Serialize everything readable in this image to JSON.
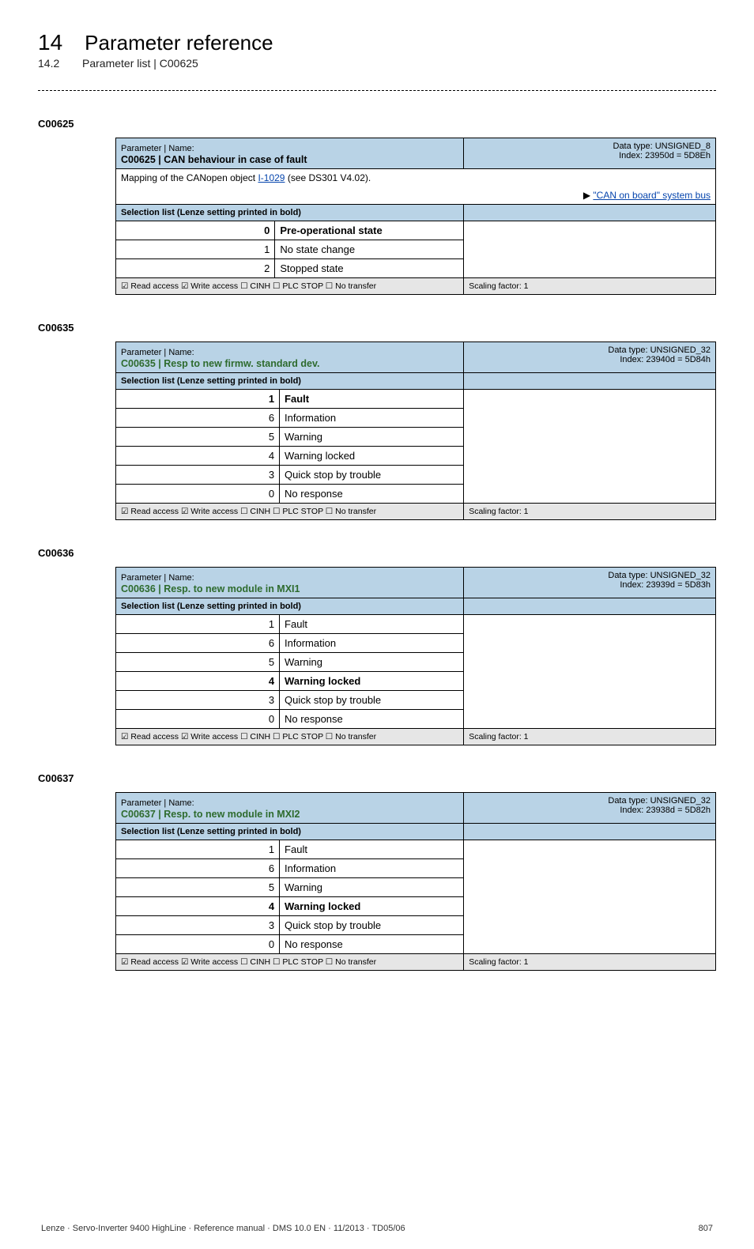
{
  "header": {
    "chapter_number": "14",
    "chapter_title": "Parameter reference",
    "sub_number": "14.2",
    "sub_title": "Parameter list | C00625"
  },
  "c00625": {
    "id": "C00625",
    "pn": "Parameter | Name:",
    "code_name": "C00625 | CAN behaviour in case of fault",
    "dtype_l1": "Data type: UNSIGNED_8",
    "dtype_l2": "Index: 23950d = 5D8Eh",
    "mapping_pre": "Mapping of the CANopen object ",
    "mapping_link": "I-1029",
    "mapping_post": "  (see DS301 V4.02).",
    "syslink": "\"CAN on board\" system bus",
    "sel": "Selection list (Lenze setting printed in bold)",
    "rows": [
      {
        "n": "0",
        "t": "Pre-operational state",
        "b": true
      },
      {
        "n": "1",
        "t": "No state change",
        "b": false
      },
      {
        "n": "2",
        "t": "Stopped state",
        "b": false
      }
    ],
    "foot_l": "☑ Read access   ☑ Write access   ☐ CINH   ☐ PLC STOP   ☐ No transfer",
    "foot_r": "Scaling factor: 1"
  },
  "c00635": {
    "id": "C00635",
    "pn": "Parameter | Name:",
    "code_name": "C00635 | Resp to new firmw. standard dev.",
    "dtype_l1": "Data type: UNSIGNED_32",
    "dtype_l2": "Index: 23940d = 5D84h",
    "sel": "Selection list (Lenze setting printed in bold)",
    "rows": [
      {
        "n": "1",
        "t": "Fault",
        "b": true
      },
      {
        "n": "6",
        "t": "Information",
        "b": false
      },
      {
        "n": "5",
        "t": "Warning",
        "b": false
      },
      {
        "n": "4",
        "t": "Warning locked",
        "b": false
      },
      {
        "n": "3",
        "t": "Quick stop by trouble",
        "b": false
      },
      {
        "n": "0",
        "t": "No response",
        "b": false
      }
    ],
    "foot_l": "☑ Read access   ☑ Write access   ☐ CINH   ☐ PLC STOP   ☐ No transfer",
    "foot_r": "Scaling factor: 1"
  },
  "c00636": {
    "id": "C00636",
    "pn": "Parameter | Name:",
    "code_name": "C00636 | Resp. to new module in MXI1",
    "dtype_l1": "Data type: UNSIGNED_32",
    "dtype_l2": "Index: 23939d = 5D83h",
    "sel": "Selection list (Lenze setting printed in bold)",
    "rows": [
      {
        "n": "1",
        "t": "Fault",
        "b": false
      },
      {
        "n": "6",
        "t": "Information",
        "b": false
      },
      {
        "n": "5",
        "t": "Warning",
        "b": false
      },
      {
        "n": "4",
        "t": "Warning locked",
        "b": true
      },
      {
        "n": "3",
        "t": "Quick stop by trouble",
        "b": false
      },
      {
        "n": "0",
        "t": "No response",
        "b": false
      }
    ],
    "foot_l": "☑ Read access   ☑ Write access   ☐ CINH   ☐ PLC STOP   ☐ No transfer",
    "foot_r": "Scaling factor: 1"
  },
  "c00637": {
    "id": "C00637",
    "pn": "Parameter | Name:",
    "code_name": "C00637 | Resp. to new module in MXI2",
    "dtype_l1": "Data type: UNSIGNED_32",
    "dtype_l2": "Index: 23938d = 5D82h",
    "sel": "Selection list (Lenze setting printed in bold)",
    "rows": [
      {
        "n": "1",
        "t": "Fault",
        "b": false
      },
      {
        "n": "6",
        "t": "Information",
        "b": false
      },
      {
        "n": "5",
        "t": "Warning",
        "b": false
      },
      {
        "n": "4",
        "t": "Warning locked",
        "b": true
      },
      {
        "n": "3",
        "t": "Quick stop by trouble",
        "b": false
      },
      {
        "n": "0",
        "t": "No response",
        "b": false
      }
    ],
    "foot_l": "☑ Read access   ☑ Write access   ☐ CINH   ☐ PLC STOP   ☐ No transfer",
    "foot_r": "Scaling factor: 1"
  },
  "footer": {
    "left": "Lenze · Servo-Inverter 9400 HighLine · Reference manual · DMS 10.0 EN · 11/2013 · TD05/06",
    "right": "807"
  }
}
